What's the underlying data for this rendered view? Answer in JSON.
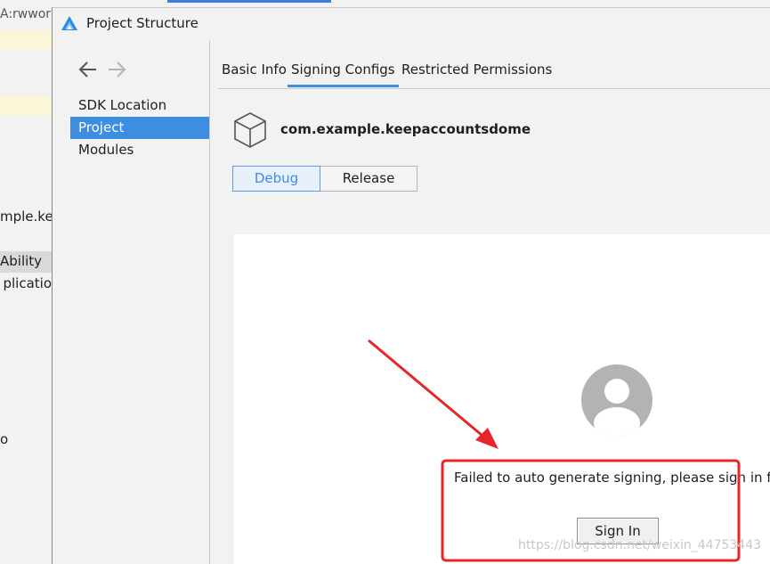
{
  "background": {
    "tab_fragment": "A:rwwork",
    "lines": [
      "mple.kee",
      "Ability",
      "plicatio",
      "o"
    ]
  },
  "dialog": {
    "title": "Project Structure",
    "icon": "app-logo-icon"
  },
  "sidebar": {
    "back_icon": "arrow-left-icon",
    "forward_icon": "arrow-right-icon",
    "items": [
      {
        "label": "SDK Location",
        "selected": false
      },
      {
        "label": "Project",
        "selected": true
      },
      {
        "label": "Modules",
        "selected": false
      }
    ]
  },
  "tabs": [
    {
      "label": "Basic Info",
      "active": false
    },
    {
      "label": "Signing Configs",
      "active": true
    },
    {
      "label": "Restricted Permissions",
      "active": false
    }
  ],
  "module": {
    "icon": "cube-icon",
    "name": "com.example.keepaccountsdome"
  },
  "build_types": {
    "debug": "Debug",
    "release": "Release",
    "selected": "Debug"
  },
  "signing": {
    "avatar_icon": "user-avatar-icon",
    "message": "Failed to auto generate signing, please sign in firs",
    "button": "Sign In"
  },
  "watermark": "https://blog.csdn.net/weixin_44753443",
  "colors": {
    "accent": "#3d8de0",
    "annotation": "#e8262a"
  }
}
